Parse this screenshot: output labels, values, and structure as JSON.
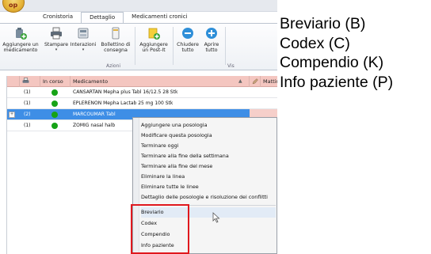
{
  "app": {
    "orb_text": "op",
    "tabs": [
      {
        "label": "Cronistoria",
        "active": false
      },
      {
        "label": "Dettaglio",
        "active": true
      },
      {
        "label": "Medicamenti cronici",
        "active": false
      }
    ]
  },
  "ribbon": {
    "buttons": [
      {
        "label1": "Aggiungere un",
        "label2": "medicamento",
        "icon": "add-medication-icon"
      },
      {
        "label1": "Stampare",
        "label2": "",
        "dropdown": "▾",
        "icon": "printer-icon"
      },
      {
        "label1": "Interazioni",
        "label2": "",
        "dropdown": "▾",
        "icon": "interactions-icon"
      },
      {
        "label1": "Bollettino di",
        "label2": "consegna",
        "icon": "delivery-slip-icon"
      },
      {
        "label1": "Aggiungere",
        "label2": "un Post-It",
        "icon": "post-it-icon"
      },
      {
        "label1": "Chiudere",
        "label2": "tutto",
        "icon": "collapse-all-icon"
      },
      {
        "label1": "Aprire",
        "label2": "tutto",
        "icon": "expand-all-icon"
      }
    ],
    "group_label": "Azioni",
    "next_group_fragment": "Vis"
  },
  "grid": {
    "columns": {
      "status": "In corso",
      "medication": "Medicamento",
      "sort_indicator": "▲",
      "next": "Mattin"
    },
    "rows": [
      {
        "qty": "(1)",
        "active": true,
        "name": "CANSARTAN Mepha plus Tabl 16/12.5 28 Stk",
        "selected": false,
        "expandable": false
      },
      {
        "qty": "(1)",
        "active": true,
        "name": "EPLERENON Mepha Lactab 25 mg 100 Stk",
        "selected": false,
        "expandable": false
      },
      {
        "qty": "(2)",
        "active": true,
        "name": "MARCOUMAR Tabl",
        "selected": true,
        "expandable": true
      },
      {
        "qty": "(1)",
        "active": true,
        "name": "ZOMIG nasal halb",
        "selected": false,
        "expandable": false
      }
    ]
  },
  "context_menu": {
    "items": [
      "Aggiungere una posologia",
      "Modificare questa posologia",
      "Terminare oggi",
      "Terminare alla fine della settimana",
      "Terminare alla fine del mese",
      "Eliminare la linea",
      "Eliminare tutte le linee",
      "Dettaglio delle posologie e risoluzione dei conflitti"
    ],
    "highlighted_items": [
      "Breviario",
      "Codex",
      "Compendio",
      "Info paziente"
    ]
  },
  "side_labels": [
    "Breviario (B)",
    "Codex (C)",
    "Compendio (K)",
    "Info paziente (P)"
  ],
  "colors": {
    "status_active": "#16a316",
    "selection": "#3e8ee6",
    "header_pink": "#f4c6c0",
    "highlight_box": "#e0181e"
  }
}
